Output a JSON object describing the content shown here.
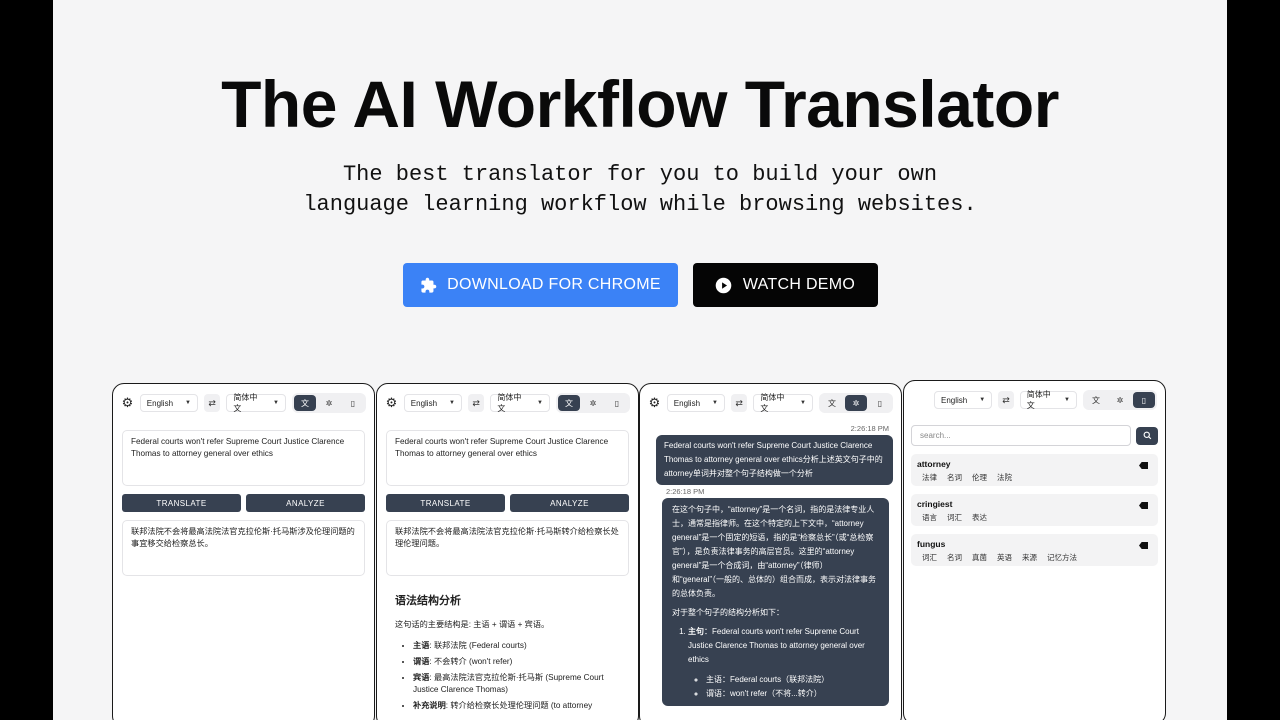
{
  "hero": {
    "title": "The AI Workflow Translator",
    "subtitle_line1": "The best translator for you to build your own",
    "subtitle_line2": "language learning workflow while browsing websites.",
    "download_label": "DOWNLOAD FOR CHROME",
    "demo_label": "WATCH DEMO"
  },
  "colors": {
    "accent": "#3b82f6",
    "dark": "#374151",
    "black": "#050505"
  },
  "toolbar": {
    "source_lang": "English",
    "target_lang": "简体中文"
  },
  "panel1": {
    "input": "Federal courts won't refer Supreme Court Justice Clarence Thomas to attorney general over ethics",
    "translate_label": "TRANSLATE",
    "analyze_label": "ANALYZE",
    "output": "联邦法院不会将最高法院法官克拉伦斯·托马斯涉及伦理问题的事宜移交给检察总长。"
  },
  "panel2": {
    "input": "Federal courts won't refer Supreme Court Justice Clarence Thomas to attorney general over ethics",
    "translate_label": "TRANSLATE",
    "analyze_label": "ANALYZE",
    "output": "联邦法院不会将最高法院法官克拉伦斯·托马斯转介给检察长处理伦理问题。",
    "grammar_title": "语法结构分析",
    "grammar_intro": "这句话的主要结构是: 主语 + 谓语 + 宾语。",
    "items": [
      {
        "label": "主语",
        "text": ": 联邦法院 (Federal courts)"
      },
      {
        "label": "谓语",
        "text": ": 不会转介 (won't refer)"
      },
      {
        "label": "宾语",
        "text": ": 最高法院法官克拉伦斯·托马斯 (Supreme Court Justice Clarence Thomas)"
      },
      {
        "label": "补充说明",
        "text": ": 转介给检察长处理伦理问题 (to attorney"
      }
    ]
  },
  "panel3": {
    "time1": "2:26:18 PM",
    "question": "Federal courts won't refer Supreme Court Justice Clarence Thomas to attorney general over ethics分析上述英文句子中的attorney单词并对整个句子结构做一个分析",
    "time2": "2:26:18 PM",
    "answer_p1": "在这个句子中，“attorney”是一个名词，指的是法律专业人士，通常是指律师。在这个特定的上下文中，“attorney general”是一个固定的短语，指的是“检察总长”（或“总检察官”），是负责法律事务的高层官员。这里的“attorney general”是一个合成词，由“attorney”（律师）和“general”（一般的、总体的）组合而成，表示对法律事务的总体负责。",
    "answer_p2": "对于整个句子的结构分析如下：",
    "main_label": "主句",
    "main_text": "：Federal courts won't refer Supreme Court Justice Clarence Thomas to attorney general over ethics",
    "sub1": "主语：Federal courts（联邦法院）",
    "sub2": "谓语：won't refer（不将...转介）"
  },
  "panel4": {
    "search_placeholder": "search...",
    "words": [
      {
        "word": "attorney",
        "tags": [
          "法律",
          "名词",
          "伦理",
          "法院"
        ]
      },
      {
        "word": "cringiest",
        "tags": [
          "语言",
          "词汇",
          "表达"
        ]
      },
      {
        "word": "fungus",
        "tags": [
          "词汇",
          "名词",
          "真菌",
          "英语",
          "来源",
          "记忆方法"
        ]
      }
    ]
  }
}
